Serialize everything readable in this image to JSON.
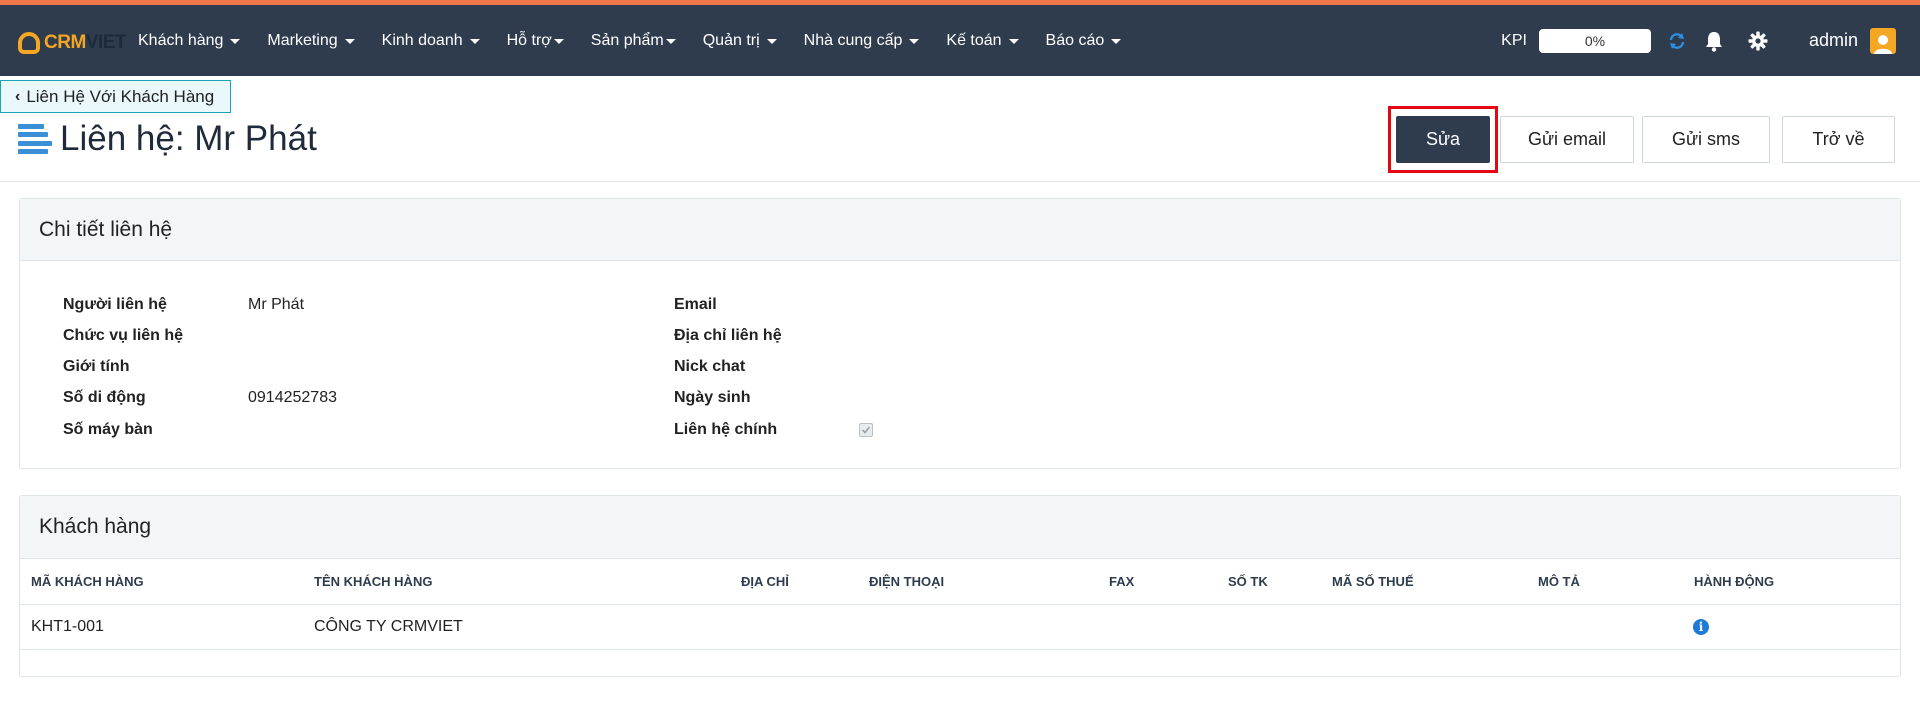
{
  "brand": {
    "logo_part1": "CRM",
    "logo_part2": "VIET",
    "accent": "#f5a623",
    "nav_bg": "#2e3c4e"
  },
  "nav": {
    "items": [
      {
        "label": "Khách hàng"
      },
      {
        "label": "Marketing"
      },
      {
        "label": "Kinh doanh"
      },
      {
        "label": "Hỗ trợ"
      },
      {
        "label": "Sản phẩm"
      },
      {
        "label": "Quản trị"
      },
      {
        "label": "Nhà cung cấp"
      },
      {
        "label": "Kế toán"
      },
      {
        "label": "Báo cáo"
      }
    ],
    "kpi_label": "KPI",
    "kpi_value": "0%",
    "user": "admin",
    "icons": [
      "refresh-icon",
      "bell-icon",
      "gear-icon",
      "user-avatar"
    ]
  },
  "breadcrumb": {
    "label": "Liên Hệ Với Khách Hàng"
  },
  "page": {
    "title": "Liên hệ: Mr Phát"
  },
  "actions": {
    "edit": "Sửa",
    "send_email": "Gửi email",
    "send_sms": "Gửi sms",
    "back": "Trở về"
  },
  "details": {
    "heading": "Chi tiết liên hệ",
    "left": [
      {
        "label": "Người liên hệ",
        "value": "Mr Phát"
      },
      {
        "label": "Chức vụ liên hệ",
        "value": ""
      },
      {
        "label": "Giới tính",
        "value": ""
      },
      {
        "label": "Số di động",
        "value": "0914252783"
      },
      {
        "label": "Số máy bàn",
        "value": ""
      }
    ],
    "right": [
      {
        "label": "Email",
        "value": ""
      },
      {
        "label": "Địa chỉ liên hệ",
        "value": ""
      },
      {
        "label": "Nick chat",
        "value": ""
      },
      {
        "label": "Ngày sinh",
        "value": ""
      },
      {
        "label": "Liên hệ chính",
        "value": "",
        "checked": true
      }
    ]
  },
  "customers": {
    "heading": "Khách hàng",
    "columns": [
      "MÃ KHÁCH HÀNG",
      "TÊN KHÁCH HÀNG",
      "ĐỊA CHỈ",
      "ĐIỆN THOẠI",
      "FAX",
      "SỐ TK",
      "MÃ SỐ THUẾ",
      "MÔ TẢ",
      "HÀNH ĐỘNG"
    ],
    "rows": [
      {
        "code": "KHT1-001",
        "name": "CÔNG TY CRMVIET",
        "address": "",
        "phone": "",
        "fax": "",
        "account": "",
        "tax": "",
        "desc": "",
        "action_icon": "info-icon"
      }
    ]
  }
}
